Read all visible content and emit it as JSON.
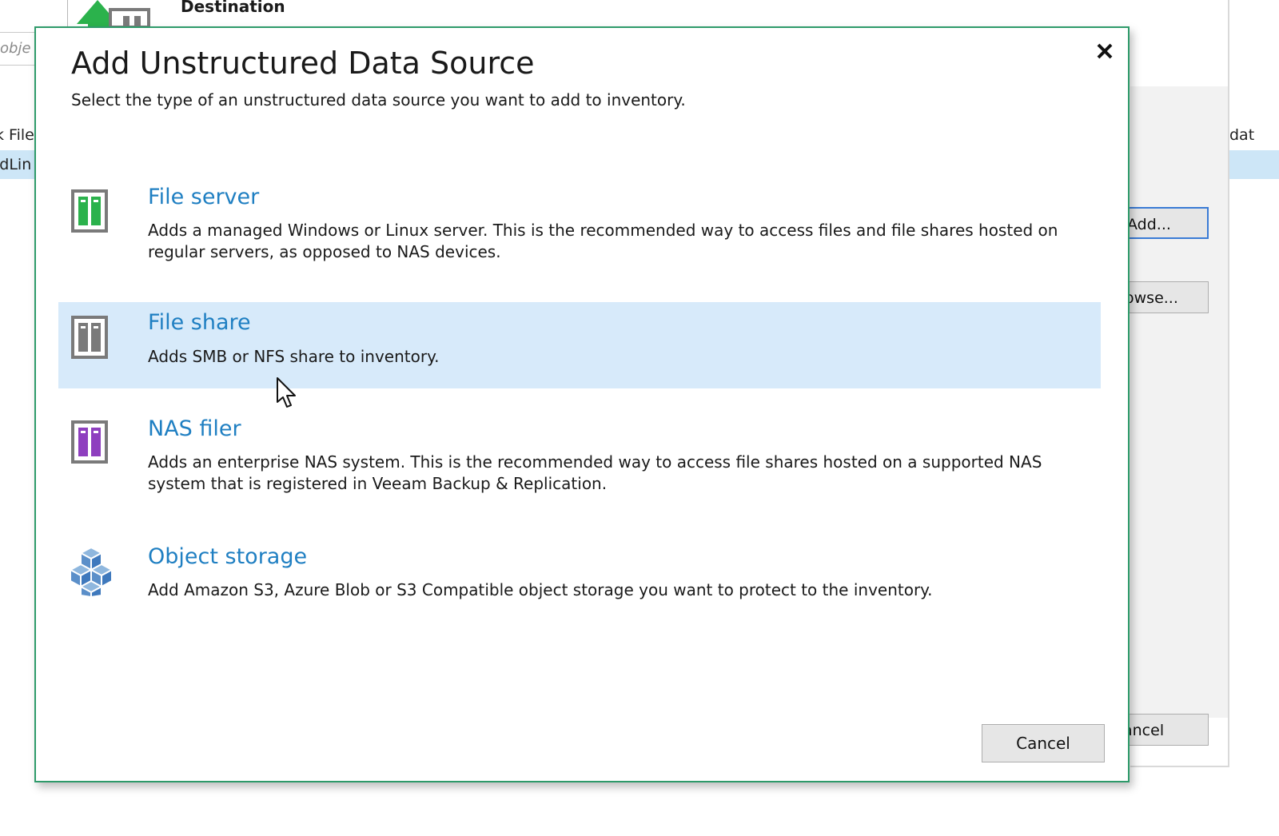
{
  "background": {
    "header_title": "Destination",
    "search_placeholder": "obje",
    "list_header": "k File",
    "list_row": "idLin",
    "right_column_header": "dat",
    "add_button": "Add...",
    "browse_button": "owse...",
    "cancel_button": "ancel"
  },
  "dialog": {
    "title": "Add Unstructured Data Source",
    "subtitle": "Select the type of an unstructured data source you want to add to inventory.",
    "options": [
      {
        "title": "File server",
        "description": "Adds a managed Windows or Linux server. This is the recommended way to access files and file shares hosted on regular servers, as opposed to NAS devices.",
        "icon": "file-server-icon",
        "icon_color": "#2bb24c"
      },
      {
        "title": "File share",
        "description": "Adds SMB or NFS share to inventory.",
        "icon": "file-share-icon",
        "icon_color": "#7a7a7a"
      },
      {
        "title": "NAS filer",
        "description": "Adds an enterprise NAS system. This is the recommended way to access file shares hosted on a supported NAS system that is registered in Veeam Backup & Replication.",
        "icon": "nas-filer-icon",
        "icon_color": "#8e3fbf"
      },
      {
        "title": "Object storage",
        "description": "Add Amazon S3, Azure Blob or S3 Compatible object storage you want to protect to the inventory.",
        "icon": "object-storage-icon",
        "icon_color": "#4f97cf"
      }
    ],
    "cancel_label": "Cancel",
    "close_icon": "close-icon"
  },
  "colors": {
    "dialog_border": "#2e9a6a",
    "link_blue": "#1f7fc2",
    "selected_row": "#d7eafa"
  }
}
